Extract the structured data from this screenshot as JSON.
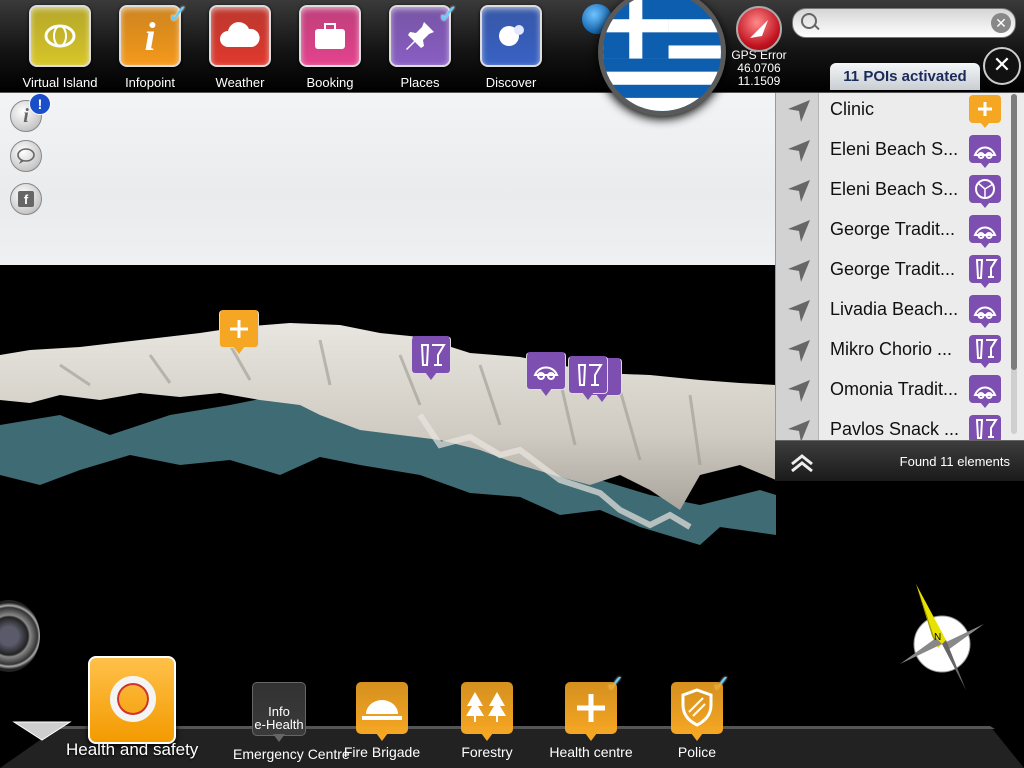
{
  "toolbar": {
    "buttons": [
      {
        "label": "Virtual Island",
        "icon": "globe-island-icon",
        "color": "#d8c62a",
        "checked": false
      },
      {
        "label": "Infopoint",
        "icon": "info-icon",
        "color": "#f59a1c",
        "checked": true
      },
      {
        "label": "Weather",
        "icon": "cloud-icon",
        "color": "#e03a2f",
        "checked": false
      },
      {
        "label": "Booking",
        "icon": "suitcase-icon",
        "color": "#e4448e",
        "checked": false
      },
      {
        "label": "Places",
        "icon": "pushpin-icon",
        "color": "#8a5fc4",
        "checked": true
      },
      {
        "label": "Discover",
        "icon": "discover-icon",
        "color": "#3a63c6",
        "checked": false
      }
    ],
    "check_glyph": "✓"
  },
  "gps": {
    "label": "GPS Error",
    "lat": "46.0706",
    "lon": "11.1509"
  },
  "search": {
    "placeholder": "",
    "value": "",
    "clear_glyph": "✕"
  },
  "poi_tab": {
    "label": "11 POIs activated",
    "close_glyph": "✕"
  },
  "side": {
    "info_badge": "!",
    "facebook": "f"
  },
  "poi_list": {
    "items": [
      {
        "name": "Clinic",
        "badge": "health",
        "color": "#f5a623"
      },
      {
        "name": "Eleni Beach S...",
        "badge": "snorkel",
        "color": "#7d4fb0"
      },
      {
        "name": "Eleni Beach S...",
        "badge": "pizza",
        "color": "#7d4fb0"
      },
      {
        "name": "George Tradit...",
        "badge": "snorkel",
        "color": "#7d4fb0"
      },
      {
        "name": "George Tradit...",
        "badge": "drinks",
        "color": "#7d4fb0"
      },
      {
        "name": "Livadia Beach...",
        "badge": "snorkel",
        "color": "#7d4fb0"
      },
      {
        "name": "Mikro Chorio ...",
        "badge": "drinks",
        "color": "#7d4fb0"
      },
      {
        "name": "Omonia Tradit...",
        "badge": "snorkel",
        "color": "#7d4fb0"
      },
      {
        "name": "Pavlos Snack ...",
        "badge": "drinks",
        "color": "#7d4fb0"
      }
    ],
    "found": "Found 11 elements"
  },
  "categories": {
    "main": {
      "label": "Health and safety",
      "color": "#f5a623"
    },
    "items": [
      {
        "label": "Emergency Centre",
        "tile_text_top": "Info",
        "tile_text_bottom": "e-Health",
        "color": "#3a3a3a",
        "checked": false
      },
      {
        "label": "Fire Brigade",
        "icon": "helmet-icon",
        "color": "#f5a623",
        "checked": false
      },
      {
        "label": "Forestry",
        "icon": "trees-icon",
        "color": "#f5a623",
        "checked": false
      },
      {
        "label": "Health centre",
        "icon": "cross-icon",
        "color": "#f5a623",
        "checked": true
      },
      {
        "label": "Police",
        "icon": "shield-icon",
        "color": "#f5a623",
        "checked": true
      }
    ]
  },
  "compass": {
    "north": "N"
  }
}
